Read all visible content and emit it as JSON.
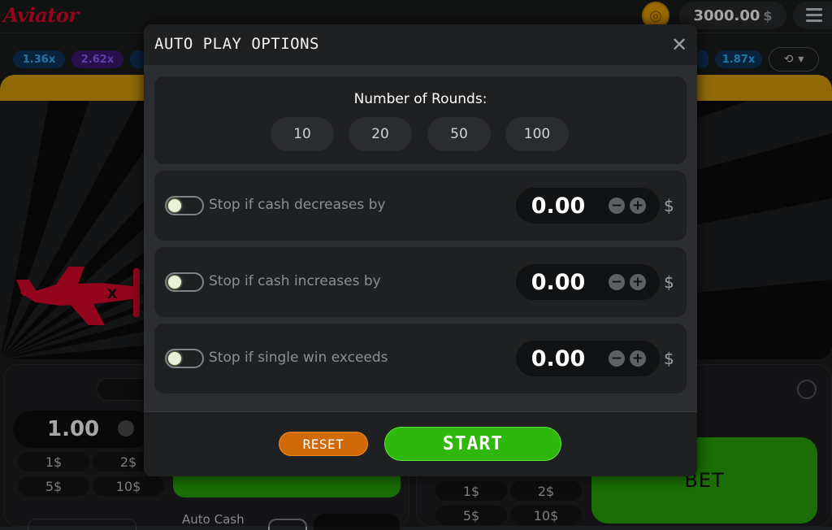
{
  "app": {
    "logo": "Aviator",
    "balance": "3000.00",
    "currency": "$"
  },
  "multipliers": [
    {
      "label": "1.36x",
      "color": "#34b4ff",
      "bg": "#12355c"
    },
    {
      "label": "2.62x",
      "color": "#9162ff",
      "bg": "#3c1a73"
    },
    {
      "label": "1.87x",
      "color": "#34b4ff",
      "bg": "#12355c"
    }
  ],
  "bet_panel": {
    "amount": "1.00",
    "quick_bets": [
      "1$",
      "2$",
      "5$",
      "10$"
    ],
    "auto_cash": "Auto Cash",
    "bet_label": "BET"
  },
  "modal": {
    "title": "AUTO PLAY OPTIONS",
    "close_icon": "close-icon",
    "rounds_label": "Number of Rounds:",
    "rounds": [
      "10",
      "20",
      "50",
      "100"
    ],
    "rules": [
      {
        "label": "Stop if cash decreases by",
        "value": "0.00",
        "currency": "$",
        "enabled": false
      },
      {
        "label": "Stop if cash increases by",
        "value": "0.00",
        "currency": "$",
        "enabled": false
      },
      {
        "label": "Stop if single win exceeds",
        "value": "0.00",
        "currency": "$",
        "enabled": false
      }
    ],
    "reset_label": "RESET",
    "start_label": "START"
  },
  "colors": {
    "brand_red": "#e0082d",
    "bet_green": "#28a909",
    "reset_orange": "#d06a08",
    "game_bar": "#dea30f"
  }
}
